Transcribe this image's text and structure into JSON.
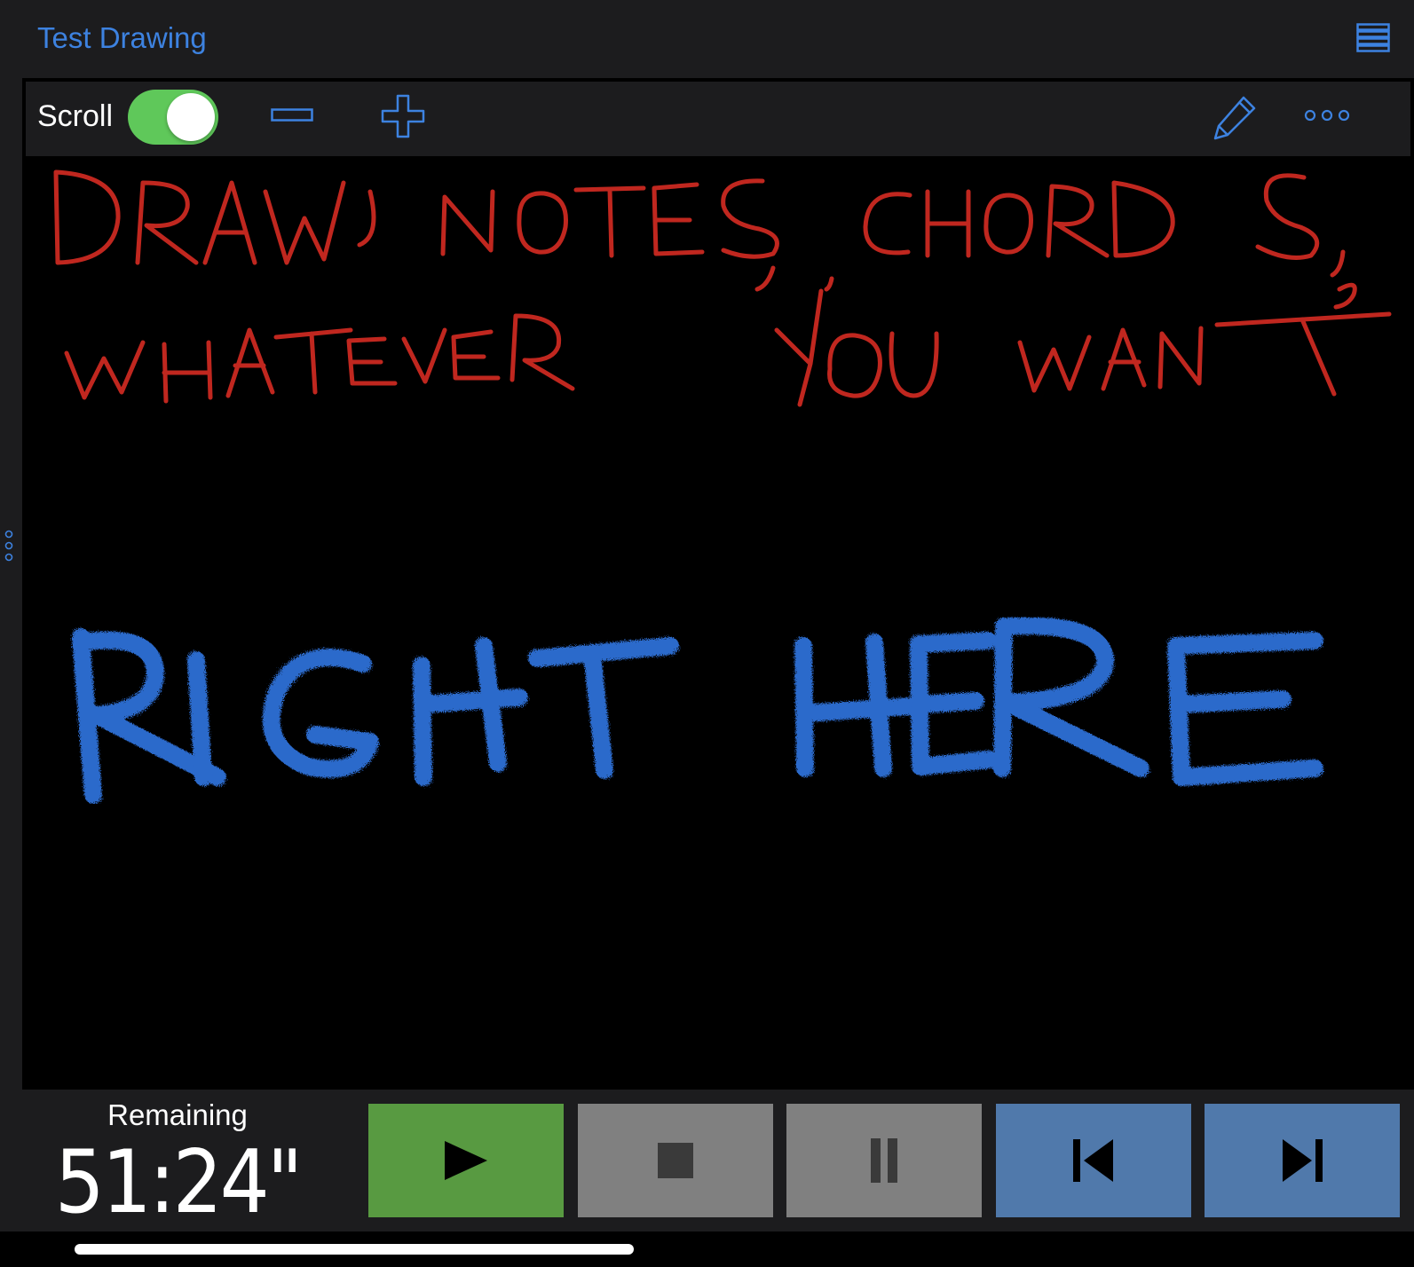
{
  "nav": {
    "title": "Test Drawing",
    "menu_icon": "list-icon"
  },
  "toolbar": {
    "scroll_label": "Scroll",
    "scroll_enabled": true,
    "icons": [
      "minus-icon",
      "plus-icon",
      "pencil-icon",
      "more-icon"
    ]
  },
  "drawing": {
    "red_lines": [
      "DRAW NOTES, CHORDS,",
      "WHATEVER YOU WANT"
    ],
    "blue_lines": [
      "RIGHT HERE"
    ]
  },
  "transport": {
    "remaining_label": "Remaining",
    "time": "51:24\"",
    "buttons": [
      "play",
      "stop",
      "pause",
      "previous",
      "next"
    ]
  },
  "colors": {
    "accent": "#3d82e0",
    "toggle_on": "#5fc85a",
    "play": "#589a41",
    "stop_pause": "#808080",
    "nav_buttons": "#5079ab",
    "ink_red": "#c0271f",
    "ink_blue": "#2f6fd6"
  }
}
